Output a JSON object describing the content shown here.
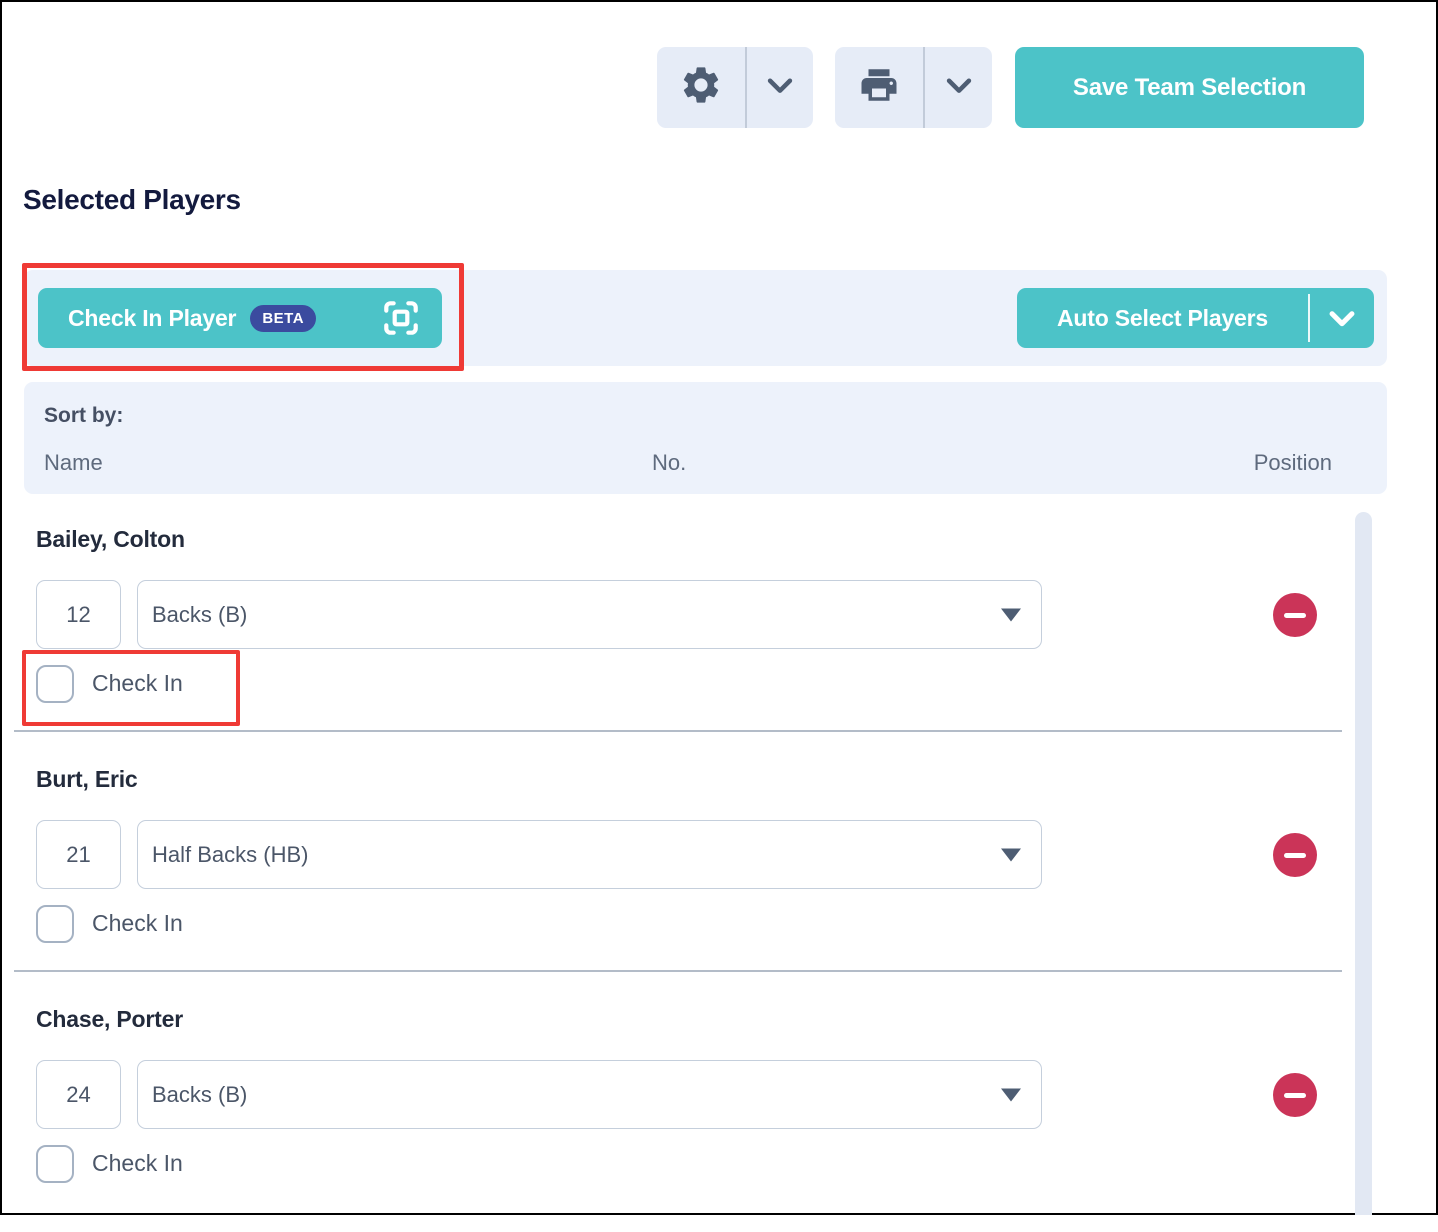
{
  "page": {
    "title": "Selected Players"
  },
  "toolbar": {
    "save_label": "Save Team Selection",
    "settings_icon": "gear-icon",
    "print_icon": "printer-icon",
    "chevron_icon": "chevron-down-icon"
  },
  "actions": {
    "check_in_player": {
      "label": "Check In Player",
      "badge": "BETA",
      "icon": "scan-icon"
    },
    "auto_select": {
      "label": "Auto Select Players"
    }
  },
  "sort": {
    "label": "Sort by:",
    "columns": [
      "Name",
      "No.",
      "Position"
    ]
  },
  "players": [
    {
      "name": "Bailey, Colton",
      "number": "12",
      "position": "Backs (B)",
      "check_in_label": "Check In",
      "checked": false
    },
    {
      "name": "Burt, Eric",
      "number": "21",
      "position": "Half Backs (HB)",
      "check_in_label": "Check In",
      "checked": false
    },
    {
      "name": "Chase, Porter",
      "number": "24",
      "position": "Backs (B)",
      "check_in_label": "Check In",
      "checked": false
    }
  ],
  "colors": {
    "teal": "#4cc3c8",
    "beta_badge": "#3b4b9f",
    "danger": "#cb3458",
    "annotation_red": "#ef3a35",
    "panel_bg": "#edf2fb",
    "toolbar_btn_bg": "#e6ecf7",
    "heading": "#131a3e",
    "icon_slate": "#4e5d73"
  }
}
